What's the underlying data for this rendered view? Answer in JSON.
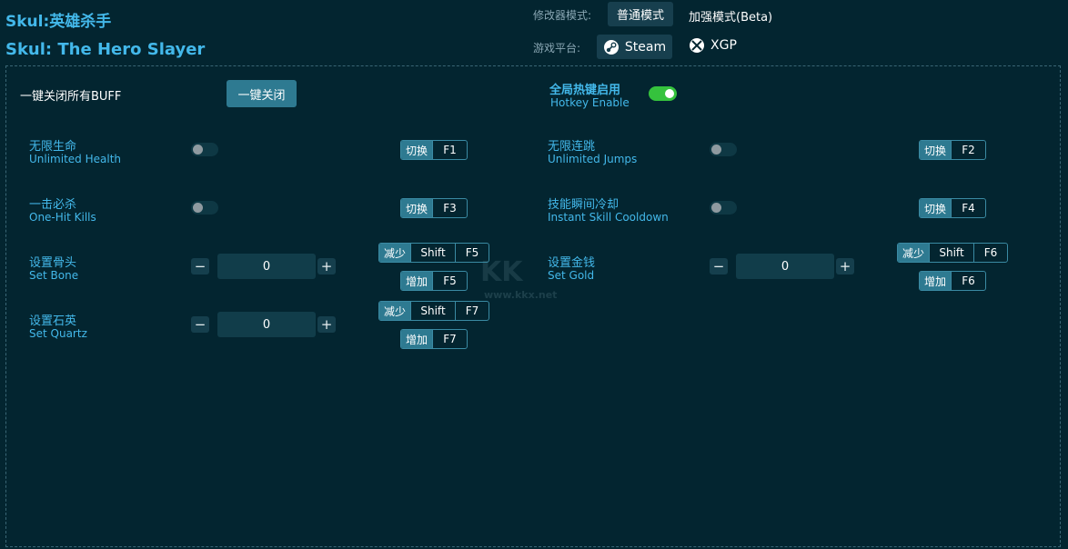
{
  "header": {
    "title_cn": "Skul:英雄杀手",
    "title_en": "Skul: The Hero Slayer",
    "mode_label": "修改器模式:",
    "mode_normal": "普通模式",
    "mode_enhanced": "加强模式(Beta)",
    "platform_label": "游戏平台:",
    "platform_steam": "Steam",
    "platform_xgp": "XGP"
  },
  "global": {
    "close_all_label": "一键关闭所有BUFF",
    "close_all_button": "一键关闭",
    "hotkey_cn": "全局热键启用",
    "hotkey_en": "Hotkey Enable",
    "hotkey_enabled": true
  },
  "cheats": [
    {
      "cn": "无限生命",
      "en": "Unlimited Health",
      "tag": "切换",
      "key": "F1",
      "on": false
    },
    {
      "cn": "无限连跳",
      "en": "Unlimited Jumps",
      "tag": "切换",
      "key": "F2",
      "on": false
    },
    {
      "cn": "一击必杀",
      "en": "One-Hit Kills",
      "tag": "切换",
      "key": "F3",
      "on": false
    },
    {
      "cn": "技能瞬间冷却",
      "en": "Instant Skill Cooldown",
      "tag": "切换",
      "key": "F4",
      "on": false
    }
  ],
  "values": [
    {
      "cn": "设置骨头",
      "en": "Set Bone",
      "value": "0",
      "dec_tag": "减少",
      "dec_mod": "Shift",
      "dec_key": "F5",
      "inc_tag": "增加",
      "inc_key": "F5"
    },
    {
      "cn": "设置金钱",
      "en": "Set Gold",
      "value": "0",
      "dec_tag": "减少",
      "dec_mod": "Shift",
      "dec_key": "F6",
      "inc_tag": "增加",
      "inc_key": "F6"
    },
    {
      "cn": "设置石英",
      "en": "Set Quartz",
      "value": "0",
      "dec_tag": "减少",
      "dec_mod": "Shift",
      "dec_key": "F7",
      "inc_tag": "增加",
      "inc_key": "F7"
    }
  ],
  "watermark": {
    "logo": "KK",
    "url": "www.kkx.net"
  },
  "icons": {
    "minus": "minus-icon",
    "plus": "plus-icon",
    "steam": "steam-icon",
    "xbox": "xbox-icon"
  },
  "colors": {
    "accent": "#43b8ea",
    "background": "#032530",
    "toggle_on": "#35c23d"
  }
}
